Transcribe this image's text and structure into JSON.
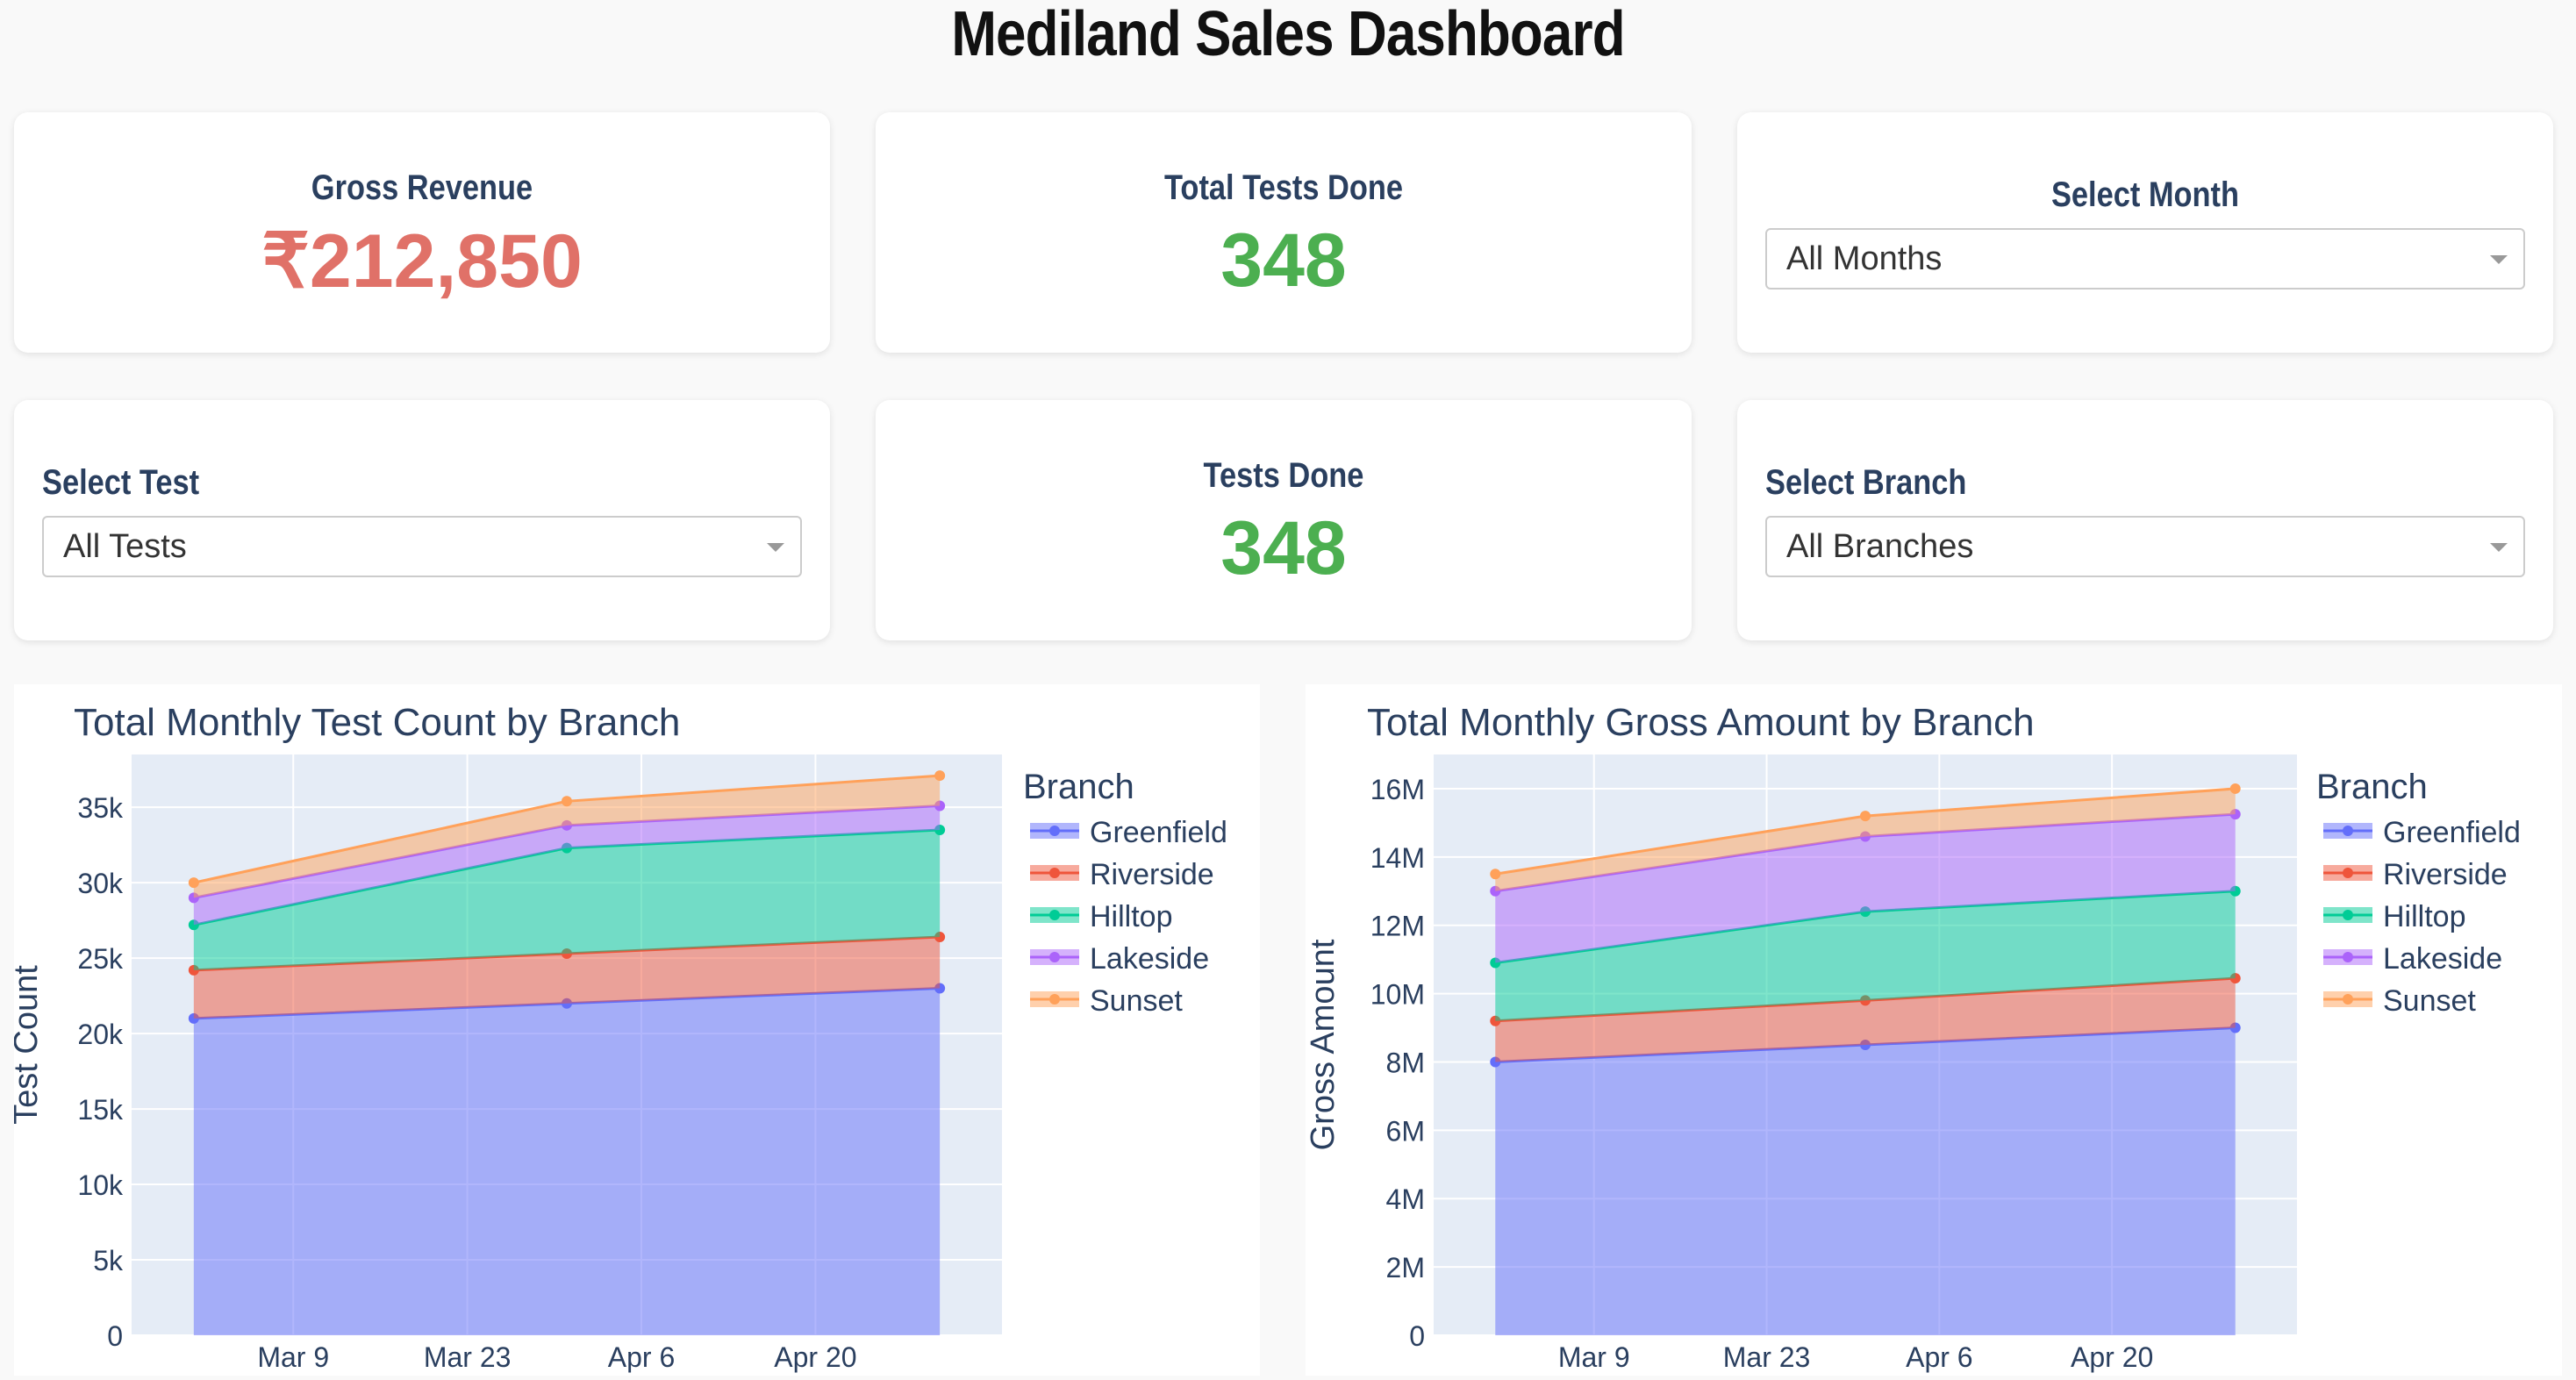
{
  "dashboard": {
    "title": "Mediland Sales Dashboard"
  },
  "kpis": {
    "gross_revenue": {
      "label": "Gross Revenue",
      "value": "₹212,850",
      "color": "#e07168"
    },
    "total_tests": {
      "label": "Total Tests Done",
      "value": "348",
      "color": "#4caf50"
    },
    "tests_done": {
      "label": "Tests Done",
      "value": "348",
      "color": "#4caf50"
    }
  },
  "filters": {
    "month": {
      "label": "Select Month",
      "value": "All Months"
    },
    "test": {
      "label": "Select Test",
      "value": "All Tests"
    },
    "branch": {
      "label": "Select Branch",
      "value": "All Branches"
    }
  },
  "colors": {
    "Greenfield": "#636efa",
    "Riverside": "#ef553b",
    "Hilltop": "#00cc96",
    "Lakeside": "#ab63fa",
    "Sunset": "#ffa15a",
    "plot_bg": "#e5ecf6",
    "text": "#2a3f5f"
  },
  "chart_data": [
    {
      "type": "area",
      "title": "Total Monthly Test Count by Branch",
      "ylabel": "Test Count",
      "xlabel": "",
      "legend_title": "Branch",
      "legend_placement": "right",
      "stacked": true,
      "grid": true,
      "x": [
        "2024-03-01",
        "2024-03-31",
        "2024-04-30"
      ],
      "x_ticks": [
        "Mar 9",
        "Mar 23",
        "Apr 6",
        "Apr 20"
      ],
      "x_tick_dates": [
        "2024-03-09",
        "2024-03-23",
        "2024-04-06",
        "2024-04-20"
      ],
      "x_range": [
        "2024-02-25",
        "2024-05-05"
      ],
      "ylim": [
        0,
        38500
      ],
      "y_ticks": [
        0,
        5000,
        10000,
        15000,
        20000,
        25000,
        30000,
        35000
      ],
      "y_tick_labels": [
        "0",
        "5k",
        "10k",
        "15k",
        "20k",
        "25k",
        "30k",
        "35k"
      ],
      "series": [
        {
          "name": "Greenfield",
          "values": [
            21000,
            22000,
            23000
          ]
        },
        {
          "name": "Riverside",
          "values": [
            3200,
            3300,
            3400
          ]
        },
        {
          "name": "Hilltop",
          "values": [
            3000,
            7000,
            7100
          ]
        },
        {
          "name": "Lakeside",
          "values": [
            1800,
            1500,
            1600
          ]
        },
        {
          "name": "Sunset",
          "values": [
            1000,
            1600,
            2000
          ]
        }
      ]
    },
    {
      "type": "area",
      "title": "Total Monthly Gross Amount by Branch",
      "ylabel": "Gross Amount",
      "xlabel": "",
      "legend_title": "Branch",
      "legend_placement": "right",
      "stacked": true,
      "grid": true,
      "x": [
        "2024-03-01",
        "2024-03-31",
        "2024-04-30"
      ],
      "x_ticks": [
        "Mar 9",
        "Mar 23",
        "Apr 6",
        "Apr 20"
      ],
      "x_tick_dates": [
        "2024-03-09",
        "2024-03-23",
        "2024-04-06",
        "2024-04-20"
      ],
      "x_range": [
        "2024-02-25",
        "2024-05-05"
      ],
      "ylim": [
        0,
        17000000
      ],
      "y_ticks": [
        0,
        2000000,
        4000000,
        6000000,
        8000000,
        10000000,
        12000000,
        14000000,
        16000000
      ],
      "y_tick_labels": [
        "0",
        "2M",
        "4M",
        "6M",
        "8M",
        "10M",
        "12M",
        "14M",
        "16M"
      ],
      "series": [
        {
          "name": "Greenfield",
          "values": [
            8000000,
            8500000,
            9000000
          ]
        },
        {
          "name": "Riverside",
          "values": [
            1200000,
            1300000,
            1450000
          ]
        },
        {
          "name": "Hilltop",
          "values": [
            1700000,
            2600000,
            2550000
          ]
        },
        {
          "name": "Lakeside",
          "values": [
            2100000,
            2200000,
            2250000
          ]
        },
        {
          "name": "Sunset",
          "values": [
            500000,
            600000,
            750000
          ]
        }
      ]
    }
  ]
}
